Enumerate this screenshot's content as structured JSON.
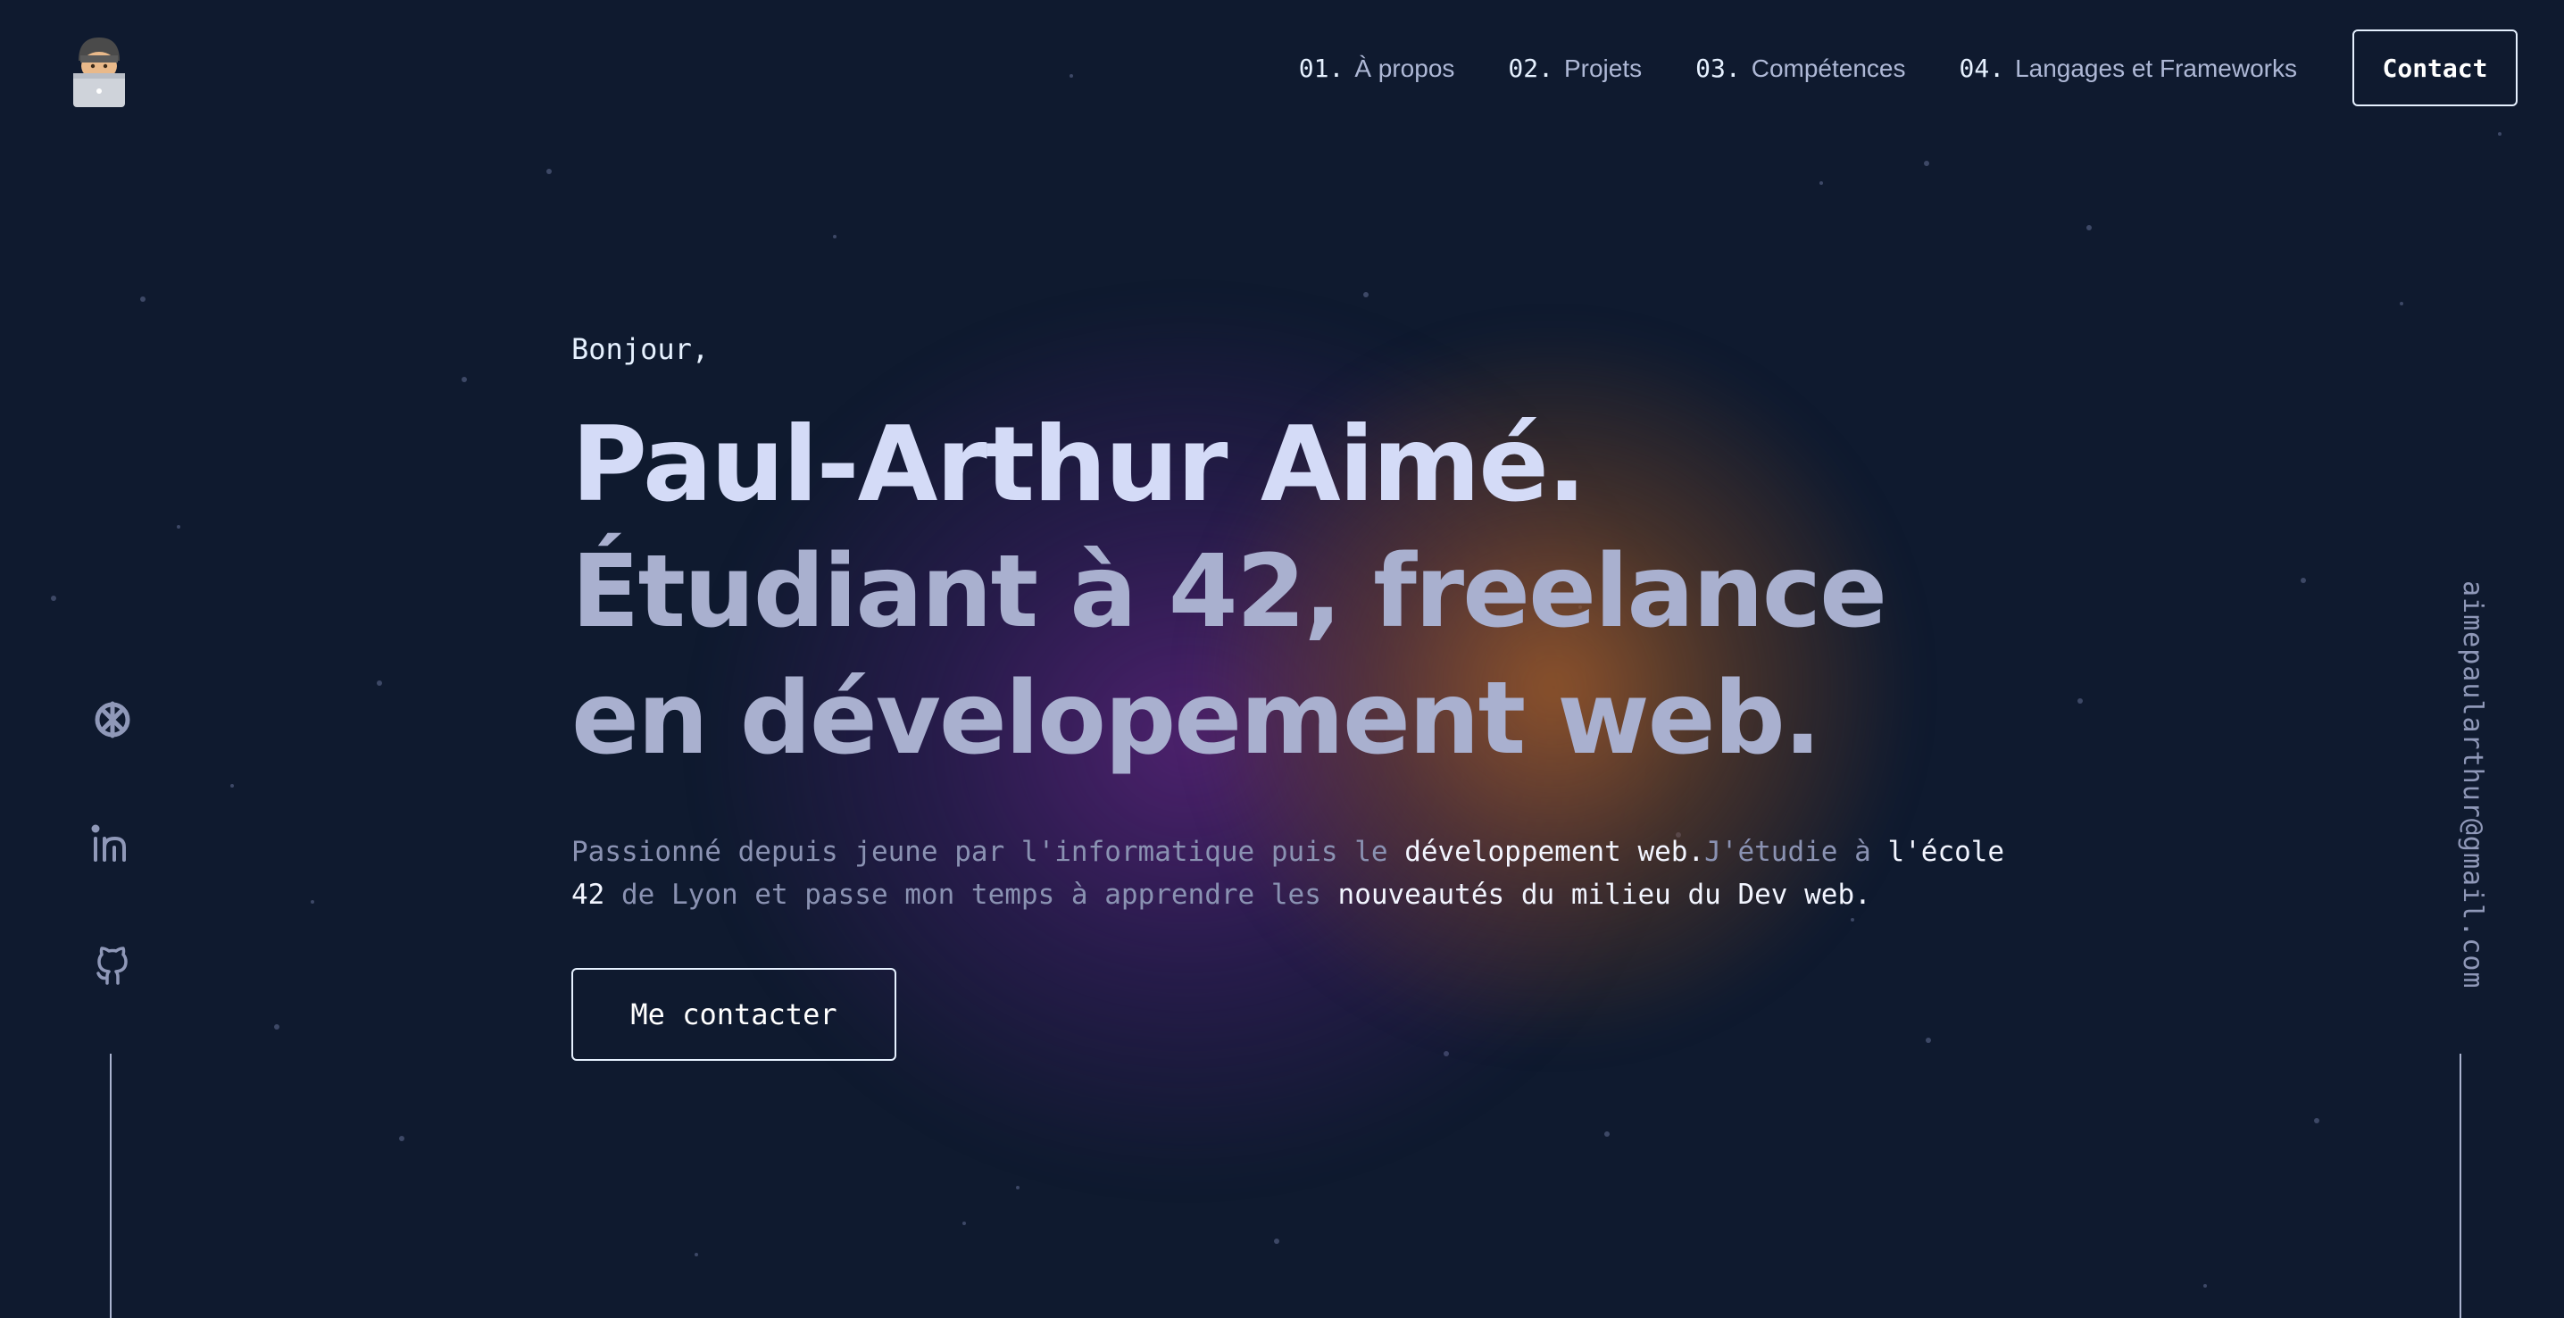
{
  "logo": {
    "icon": "technologist-emoji-icon"
  },
  "nav": {
    "items": [
      {
        "num": "01.",
        "label": "À propos"
      },
      {
        "num": "02.",
        "label": "Projets"
      },
      {
        "num": "03.",
        "label": "Compétences"
      },
      {
        "num": "04.",
        "label": "Langages et Frameworks"
      }
    ],
    "contact_label": "Contact"
  },
  "hero": {
    "greeting": "Bonjour,",
    "name": "Paul-Arthur Aimé.",
    "tagline": "Étudiant à 42, freelance en dévelopement web.",
    "description": {
      "part1": "Passionné depuis jeune par l'informatique puis le ",
      "hl1": "développement web.",
      "part2": "J'étudie à ",
      "hl2": "l'école 42",
      "part3": " de Lyon et passe mon temps à apprendre les ",
      "hl3": "nouveautés du milieu du Dev web",
      "part4": "."
    },
    "cta_label": "Me contacter"
  },
  "socials": [
    {
      "name": "42-icon"
    },
    {
      "name": "linkedin-icon"
    },
    {
      "name": "github-icon"
    }
  ],
  "email": "aimepaularthur@gmail.com",
  "colors": {
    "background": "#0f1a2f",
    "heading": "#d4dbf7",
    "subheading": "#a9b0cf",
    "muted": "#8a92b2",
    "highlight": "#f2f5ff",
    "glow_purple": "#622482",
    "glow_orange": "#a05c28"
  }
}
